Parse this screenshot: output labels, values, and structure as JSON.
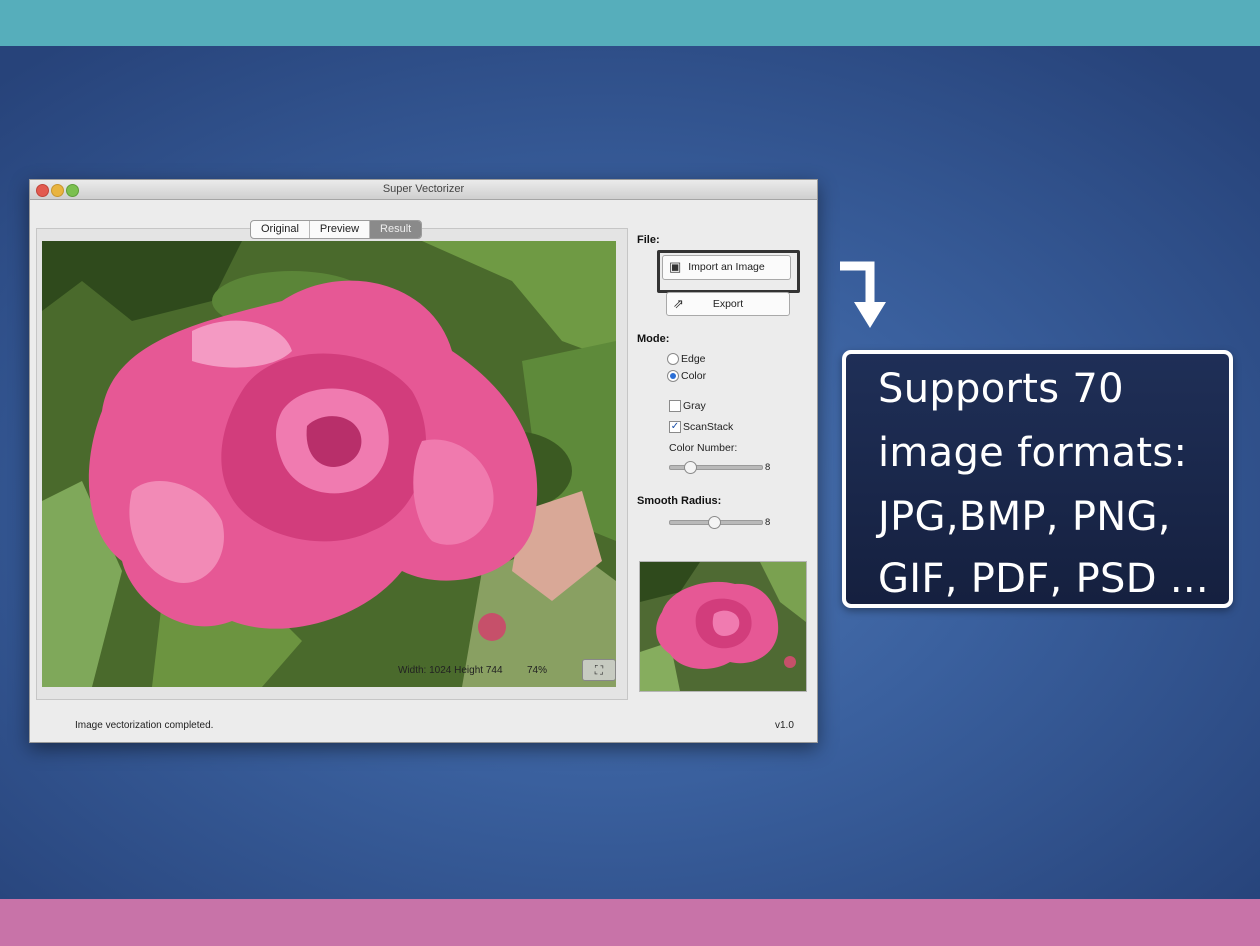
{
  "window": {
    "title": "Super Vectorizer",
    "tabs": [
      {
        "label": "Original",
        "active": false
      },
      {
        "label": "Preview",
        "active": false
      },
      {
        "label": "Result",
        "active": true
      }
    ],
    "canvas": {
      "dimensions_text": "Width: 1024  Height 744",
      "zoom_text": "74%"
    },
    "file": {
      "heading": "File:",
      "import_label": "Import an Image",
      "export_label": "Export"
    },
    "mode": {
      "heading": "Mode:",
      "edge_label": "Edge",
      "color_label": "Color",
      "selected": "Color",
      "gray_label": "Gray",
      "gray_checked": false,
      "scanstack_label": "ScanStack",
      "scanstack_checked": true,
      "color_number_label": "Color Number:",
      "color_number_value": "8"
    },
    "smooth": {
      "heading": "Smooth Radius:",
      "value": "8"
    },
    "status_text": "Image vectorization completed.",
    "version": "v1.0"
  },
  "callout": {
    "lines": [
      "Supports 70",
      "image formats:",
      "JPG,BMP, PNG,",
      "GIF, PDF, PSD ..."
    ]
  },
  "colors": {
    "top_strip": "#56aebb",
    "bottom_strip": "#c873a8",
    "backdrop": "#3a609e",
    "callout_bg": "#1f2f57"
  }
}
